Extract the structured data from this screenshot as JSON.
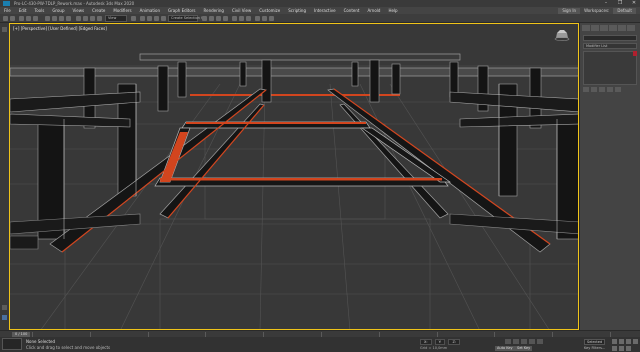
{
  "window": {
    "title": "Pro-LC-430-PW-7DLP_Rework.max - Autodesk 3ds Max 2020",
    "controls": [
      "–",
      "❐",
      "✕"
    ]
  },
  "menu": {
    "items": [
      "File",
      "Edit",
      "Tools",
      "Group",
      "Views",
      "Create",
      "Modifiers",
      "Animation",
      "Graph Editors",
      "Rendering",
      "Civil View",
      "Customize",
      "Scripting",
      "Interactive",
      "Content",
      "Arnold",
      "Help"
    ],
    "user": "Sign In",
    "workspace": "Workspaces:",
    "workspace_value": "Default"
  },
  "toolbar": {
    "named_selection": "Create Selection Se",
    "view_label": "View"
  },
  "viewport": {
    "label": "[+] [Perspective] [User Defined] [Edged Faces]"
  },
  "command_panel": {
    "object_name": "",
    "modifier_list": "Modifier List"
  },
  "timeline": {
    "frame": "0 / 100"
  },
  "status": {
    "selection": "None Selected",
    "prompt": "Click and drag to select and move objects",
    "x_label": "X:",
    "y_label": "Y:",
    "z_label": "Z:",
    "grid": "Grid = 10,0mm",
    "auto_key": "Auto Key",
    "set_key": "Set Key",
    "selected": "Selected",
    "key_filters": "Key Filters..."
  },
  "colors": {
    "accent_orange": "#d2451e",
    "viewport_bg": "#383838",
    "object_swatch": "#b0202e"
  }
}
